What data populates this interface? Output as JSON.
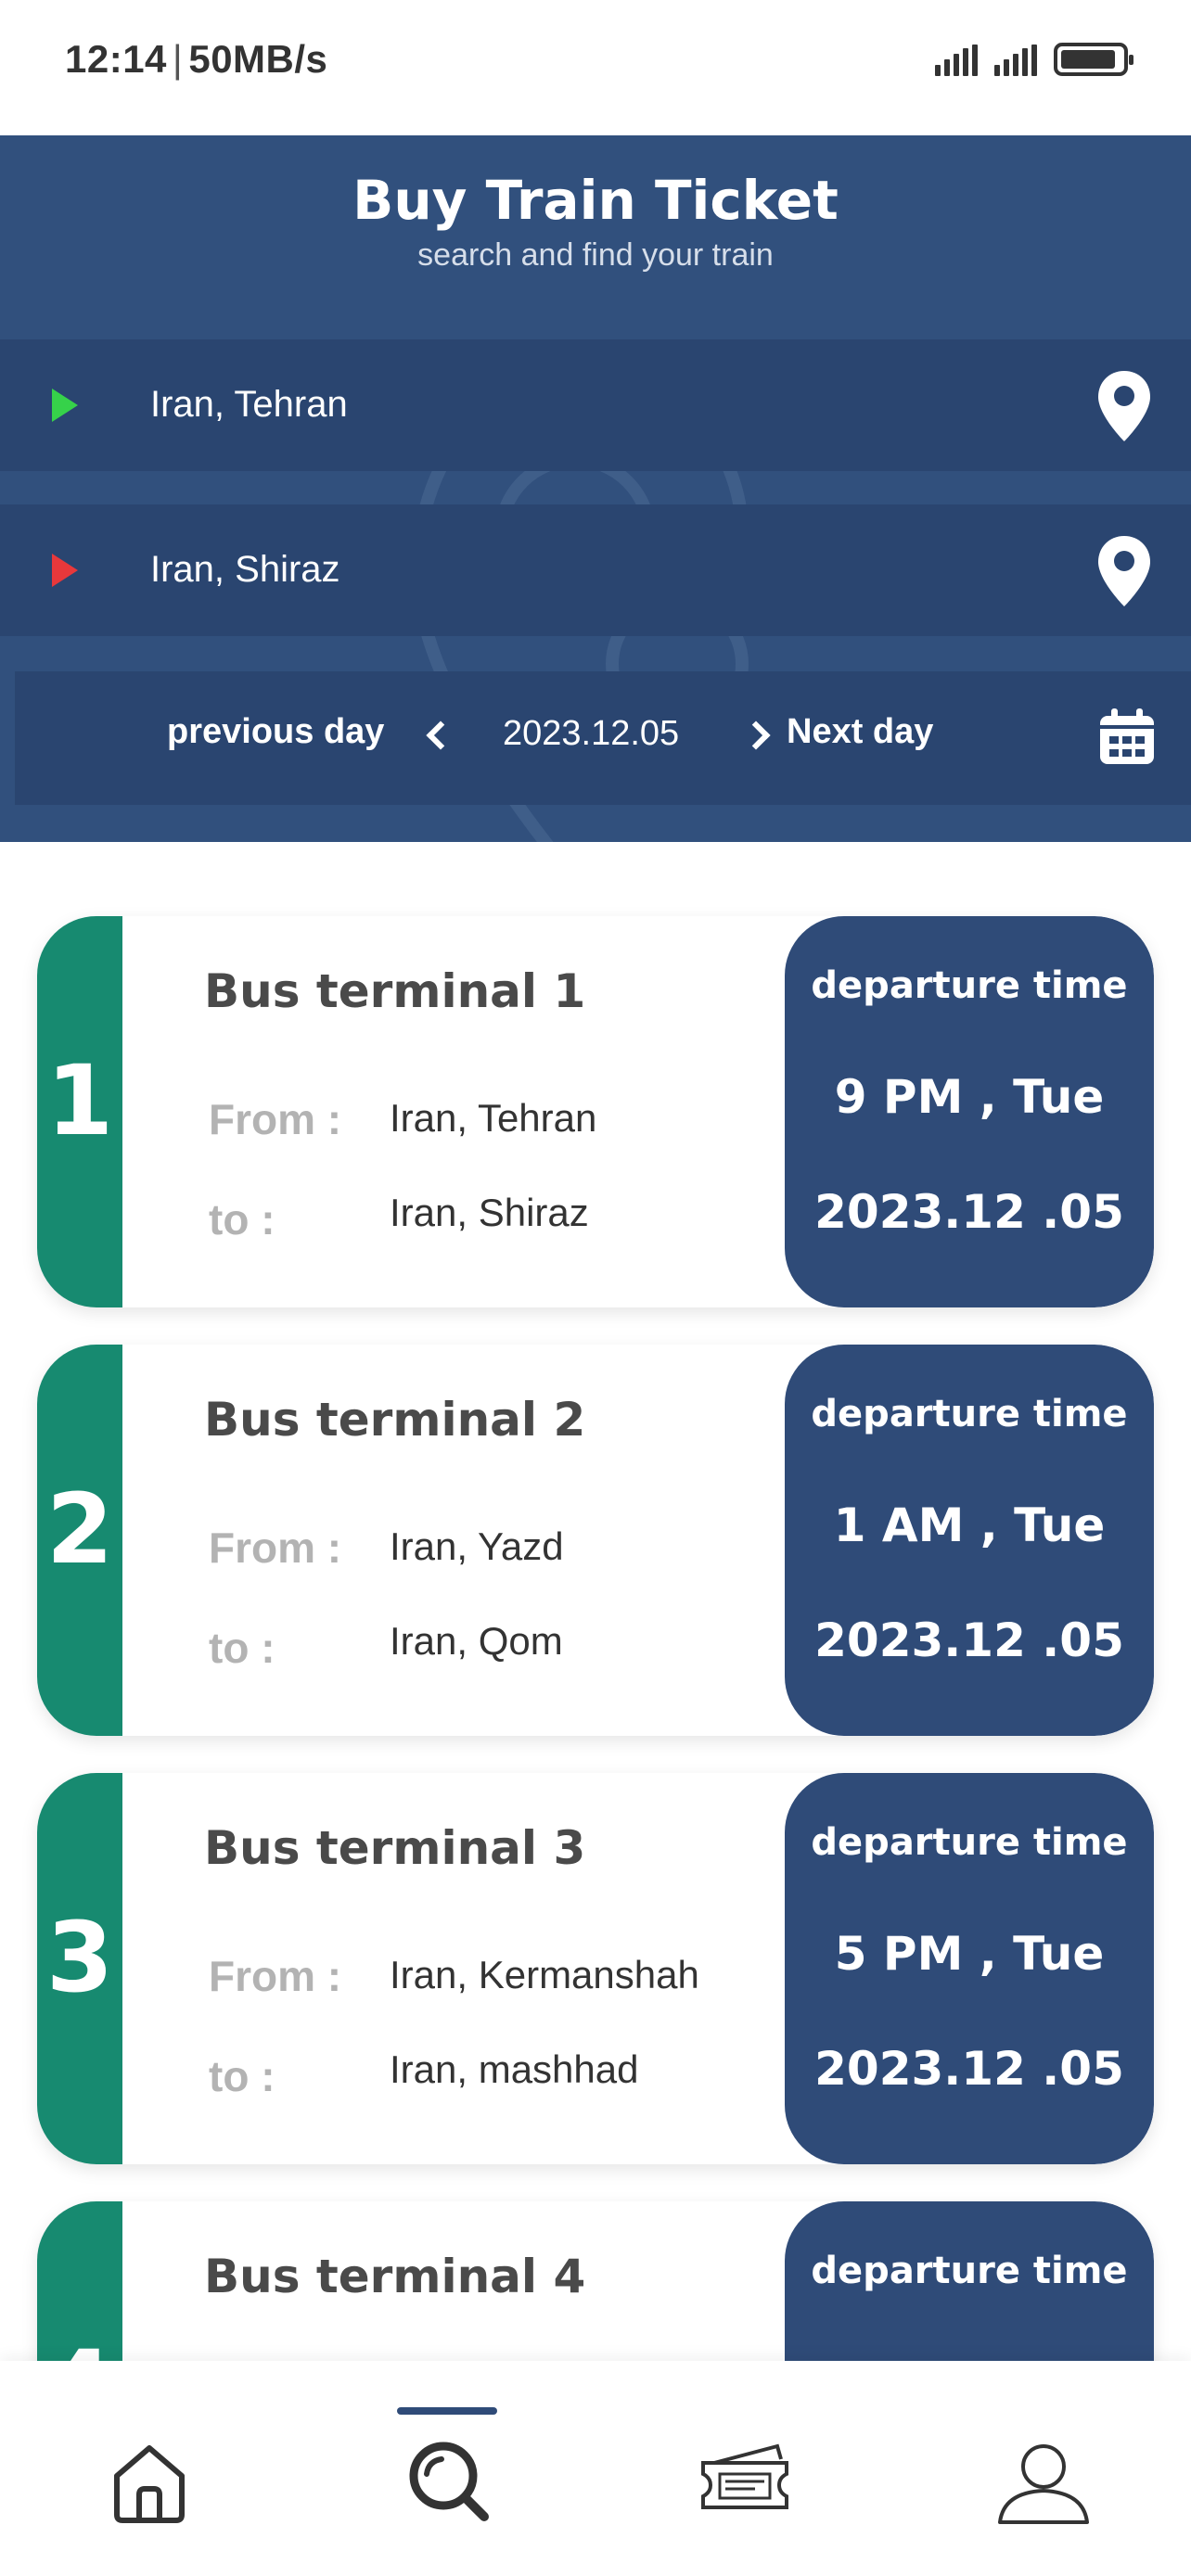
{
  "status_bar": {
    "time": "12:14",
    "speed": "50MB/s"
  },
  "header": {
    "title": "Buy Train Ticket",
    "subtitle": "search and find your train",
    "origin": "Iran, Tehran",
    "destination": "Iran, Shiraz",
    "previous_day_label": "previous day",
    "current_date": "2023.12.05",
    "next_day_label": "Next day"
  },
  "labels": {
    "from": "From :",
    "to": "to :"
  },
  "trips": [
    {
      "number": "1",
      "terminal": "Bus terminal 1",
      "from": "Iran, Tehran",
      "to": "Iran, Shiraz",
      "dep_label": "departure time",
      "dep_time": "9 PM , Tue",
      "dep_date": "2023.12 .05"
    },
    {
      "number": "2",
      "terminal": "Bus terminal 2",
      "from": "Iran, Yazd",
      "to": "Iran, Qom",
      "dep_label": "departure time",
      "dep_time": "1 AM , Tue",
      "dep_date": "2023.12 .05"
    },
    {
      "number": "3",
      "terminal": "Bus terminal 3",
      "from": "Iran, Kermanshah",
      "to": "Iran, mashhad",
      "dep_label": "departure time",
      "dep_time": "5 PM , Tue",
      "dep_date": "2023.12 .05"
    },
    {
      "number": "4",
      "terminal": "Bus terminal 4",
      "from": "",
      "to": "",
      "dep_label": "departure time",
      "dep_time": "",
      "dep_date": ""
    }
  ],
  "nav": {
    "items": [
      {
        "icon": "home-icon"
      },
      {
        "icon": "search-icon",
        "active": true
      },
      {
        "icon": "ticket-icon"
      },
      {
        "icon": "profile-icon"
      }
    ],
    "active_color": "#2f4b78"
  },
  "colors": {
    "header_bg": "#31507d",
    "accent_green": "#178a70",
    "departure_bg": "#2f4b78",
    "origin_marker": "#36d24a",
    "destination_marker": "#e8383b"
  }
}
